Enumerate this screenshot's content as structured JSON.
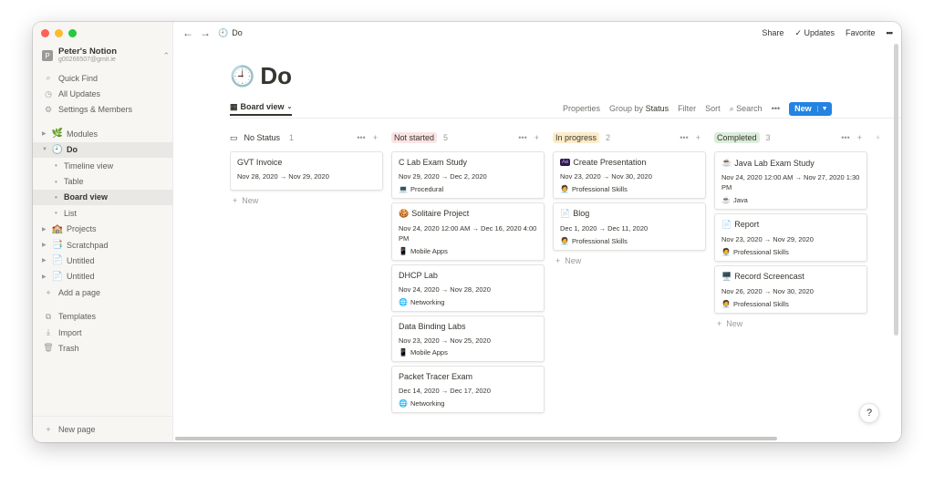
{
  "sidebar": {
    "workspace_badge": "P",
    "workspace_name": "Peter's Notion",
    "workspace_email": "g00266507@gmit.ie",
    "quick_find": "Quick Find",
    "all_updates": "All Updates",
    "settings": "Settings & Members",
    "modules": "Modules",
    "do": "Do",
    "sub_timeline": "Timeline view",
    "sub_table": "Table",
    "sub_board": "Board view",
    "sub_list": "List",
    "projects": "Projects",
    "scratchpad": "Scratchpad",
    "untitled_1": "Untitled",
    "untitled_2": "Untitled",
    "add_page": "Add a page",
    "templates": "Templates",
    "import": "Import",
    "trash": "Trash",
    "new_page": "New page"
  },
  "topbar": {
    "breadcrumb": "Do",
    "share": "Share",
    "updates": "Updates",
    "favorite": "Favorite"
  },
  "page": {
    "title": "Do"
  },
  "viewbar": {
    "view_label": "Board view",
    "properties": "Properties",
    "group_by": "Group by",
    "group_by_value": "Status",
    "filter": "Filter",
    "sort": "Sort",
    "search": "Search",
    "new": "New"
  },
  "columns": [
    {
      "name": "No Status",
      "count": "1",
      "color": "#ffffff",
      "cards": [
        {
          "icon": "",
          "title": "GVT Invoice",
          "date": "Nov 28, 2020 → Nov 29, 2020",
          "tag_icon": "",
          "tag": ""
        }
      ],
      "new": "New"
    },
    {
      "name": "Not started",
      "count": "5",
      "color": "#fbe4e4",
      "cards": [
        {
          "icon": "",
          "title": "C Lab Exam Study",
          "date": "Nov 29, 2020 → Dec 2, 2020",
          "tag_icon": "💻",
          "tag": "Procedural"
        },
        {
          "icon": "🍪",
          "title": "Solitaire Project",
          "date": "Nov 24, 2020 12:00 AM → Dec 16, 2020 4:00 PM",
          "tag_icon": "📱",
          "tag": "Mobile Apps"
        },
        {
          "icon": "",
          "title": "DHCP Lab",
          "date": "Nov 24, 2020 → Nov 28, 2020",
          "tag_icon": "🌐",
          "tag": "Networking"
        },
        {
          "icon": "",
          "title": "Data Binding Labs",
          "date": "Nov 23, 2020 → Nov 25, 2020",
          "tag_icon": "📱",
          "tag": "Mobile Apps"
        },
        {
          "icon": "",
          "title": "Packet Tracer Exam",
          "date": "Dec 14, 2020 → Dec 17, 2020",
          "tag_icon": "🌐",
          "tag": "Networking"
        }
      ],
      "new": ""
    },
    {
      "name": "In progress",
      "count": "2",
      "color": "#fdecc8",
      "cards": [
        {
          "icon": "Ae",
          "title": "Create Presentation",
          "date": "Nov 23, 2020 → Nov 30, 2020",
          "tag_icon": "🧑‍💼",
          "tag": "Professional Skills"
        },
        {
          "icon": "📄",
          "title": "Blog",
          "date": "Dec 1, 2020 → Dec 11, 2020",
          "tag_icon": "🧑‍💼",
          "tag": "Professional Skills"
        }
      ],
      "new": "New"
    },
    {
      "name": "Completed",
      "count": "3",
      "color": "#dbeddb",
      "cards": [
        {
          "icon": "☕",
          "title": "Java Lab Exam Study",
          "date": "Nov 24, 2020 12:00 AM → Nov 27, 2020 1:30 PM",
          "tag_icon": "☕",
          "tag": "Java"
        },
        {
          "icon": "📄",
          "title": "Report",
          "date": "Nov 23, 2020 → Nov 29, 2020",
          "tag_icon": "🧑‍💼",
          "tag": "Professional Skills"
        },
        {
          "icon": "🖥️",
          "title": "Record Screencast",
          "date": "Nov 26, 2020 → Nov 30, 2020",
          "tag_icon": "🧑‍💼",
          "tag": "Professional Skills"
        }
      ],
      "new": "New"
    }
  ],
  "help": "?",
  "colors": {
    "accent": "#2383e2",
    "sidebar_bg": "#f7f6f3"
  }
}
